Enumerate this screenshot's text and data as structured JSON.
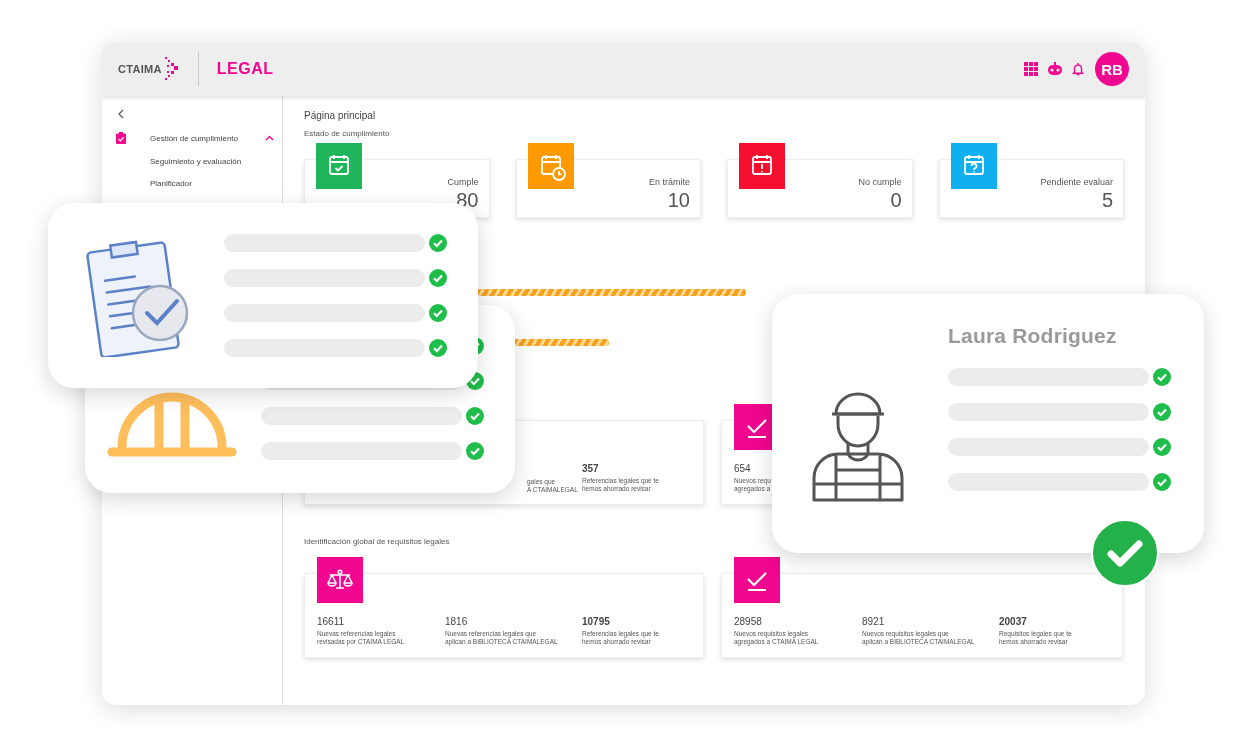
{
  "header": {
    "brand": "CTAIMA",
    "product": "LEGAL",
    "avatar": "RB"
  },
  "sidebar": {
    "items": [
      {
        "label": "Gestión de cumplimiento",
        "expanded": true,
        "children": [
          {
            "label": "Seguimiento y evaluación"
          },
          {
            "label": "Planificador"
          }
        ]
      }
    ]
  },
  "page_title": "Página principal",
  "status": {
    "title": "Estado de cumplimiento",
    "cards": [
      {
        "kind": "check",
        "color": "#1fb55a",
        "label": "Cumple",
        "value": "80"
      },
      {
        "kind": "clock",
        "color": "#ff9900",
        "label": "En trámite",
        "value": "10"
      },
      {
        "kind": "alert",
        "color": "#f5102f",
        "label": "No cumple",
        "value": "0"
      },
      {
        "kind": "question",
        "color": "#10aff0",
        "label": "Pendiente evaluar",
        "value": "5"
      }
    ]
  },
  "review_cards": [
    {
      "kind": "covered",
      "stats": [
        {
          "kind": "fragment",
          "desc": "gales que\nA CTAIMALEGAL"
        },
        {
          "kind": "total",
          "value": "357",
          "desc": "Referencias legales que te\nhemos ahorrado revisar"
        }
      ]
    },
    {
      "kind": "check",
      "stats": [
        {
          "kind": "stat",
          "value": "654",
          "desc": "Nuevos requ\nagregados a"
        }
      ]
    }
  ],
  "global": {
    "title": "Identificación global de requisitos legales",
    "cards": [
      {
        "kind": "scales",
        "stats": [
          {
            "kind": "stat",
            "value": "16611",
            "desc": "Nuevas referencias legales\nrevisadas por CTAIMA LEGAL"
          },
          {
            "kind": "stat",
            "value": "1816",
            "desc": "Nuevas referencias legales que\naplican a BIBLIOTECA CTAIMALEGAL"
          },
          {
            "kind": "total",
            "value": "10795",
            "desc": "Referencias legales que te\nhemos ahorrado revisar"
          }
        ]
      },
      {
        "kind": "check",
        "stats": [
          {
            "kind": "stat",
            "value": "28958",
            "desc": "Nuevos requisitos legales\nagregados a CTAIMA LEGAL"
          },
          {
            "kind": "stat",
            "value": "8921",
            "desc": "Nuevos requisitos legales que\naplican a BIBLIOTECA CTAIMALEGAL"
          },
          {
            "kind": "total",
            "value": "20037",
            "desc": "Requisitos legales que te\nhemos ahorrado revisar"
          }
        ]
      }
    ]
  },
  "profile_card": {
    "name": "Laura Rodriguez"
  }
}
